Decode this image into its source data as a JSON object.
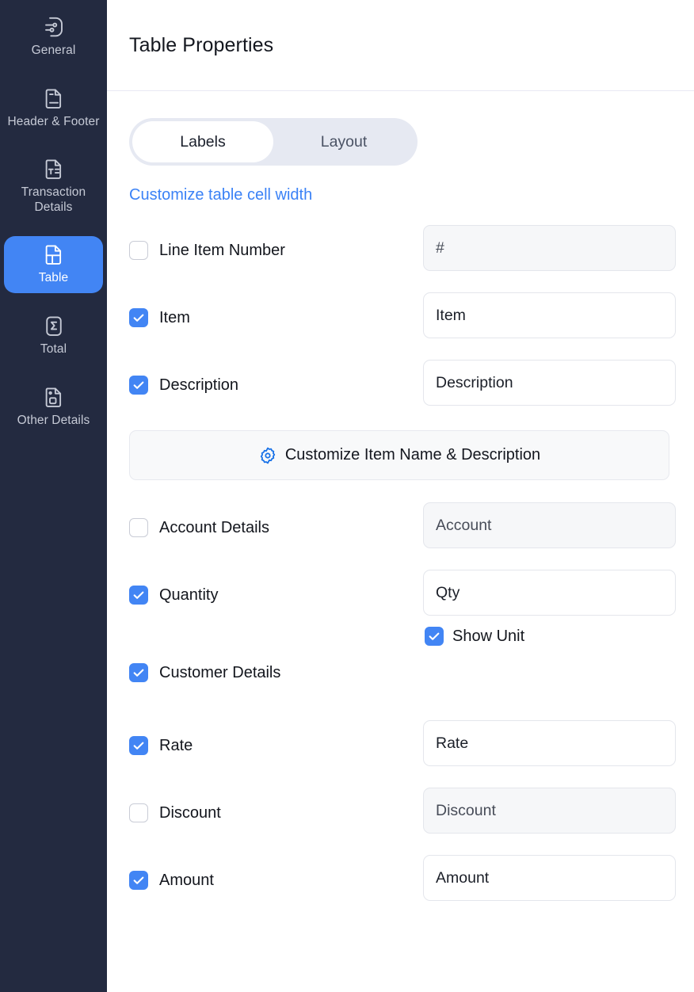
{
  "sidebar": {
    "items": [
      {
        "id": "general",
        "label": "General",
        "icon": "settings-document-icon",
        "active": false
      },
      {
        "id": "header-footer",
        "label": "Header & Footer",
        "icon": "document-lines-icon",
        "active": false
      },
      {
        "id": "transaction-details",
        "label": "Transaction Details",
        "icon": "document-text-icon",
        "active": false
      },
      {
        "id": "table",
        "label": "Table",
        "icon": "table-document-icon",
        "active": true
      },
      {
        "id": "total",
        "label": "Total",
        "icon": "sigma-document-icon",
        "active": false
      },
      {
        "id": "other-details",
        "label": "Other Details",
        "icon": "document-box-icon",
        "active": false
      }
    ]
  },
  "header": {
    "title": "Table Properties"
  },
  "tabs": [
    {
      "id": "labels",
      "label": "Labels",
      "active": true
    },
    {
      "id": "layout",
      "label": "Layout",
      "active": false
    }
  ],
  "links": {
    "customize_cell_width": "Customize table cell width"
  },
  "customize_button": {
    "label": "Customize Item Name & Description",
    "icon": "gear-icon"
  },
  "rows": [
    {
      "id": "line-item-number",
      "label": "Line Item Number",
      "checked": false,
      "field_value": "#",
      "field_disabled": true
    },
    {
      "id": "item",
      "label": "Item",
      "checked": true,
      "field_value": "Item",
      "field_disabled": false
    },
    {
      "id": "description",
      "label": "Description",
      "checked": true,
      "field_value": "Description",
      "field_disabled": false
    },
    {
      "id": "account-details",
      "label": "Account Details",
      "checked": false,
      "field_value": "Account",
      "field_disabled": true
    },
    {
      "id": "quantity",
      "label": "Quantity",
      "checked": true,
      "field_value": "Qty",
      "field_disabled": false
    },
    {
      "id": "customer-details",
      "label": "Customer Details",
      "checked": true,
      "field_value": null,
      "field_disabled": false
    },
    {
      "id": "rate",
      "label": "Rate",
      "checked": true,
      "field_value": "Rate",
      "field_disabled": false
    },
    {
      "id": "discount",
      "label": "Discount",
      "checked": false,
      "field_value": "Discount",
      "field_disabled": true
    },
    {
      "id": "amount",
      "label": "Amount",
      "checked": true,
      "field_value": "Amount",
      "field_disabled": false
    }
  ],
  "show_unit": {
    "label": "Show Unit",
    "checked": true
  },
  "colors": {
    "accent_blue": "#4285f4",
    "link_blue": "#3b82f6",
    "sidebar_bg": "#232a40",
    "tab_track": "#e6e9f2",
    "field_disabled_bg": "#f6f7f9"
  }
}
